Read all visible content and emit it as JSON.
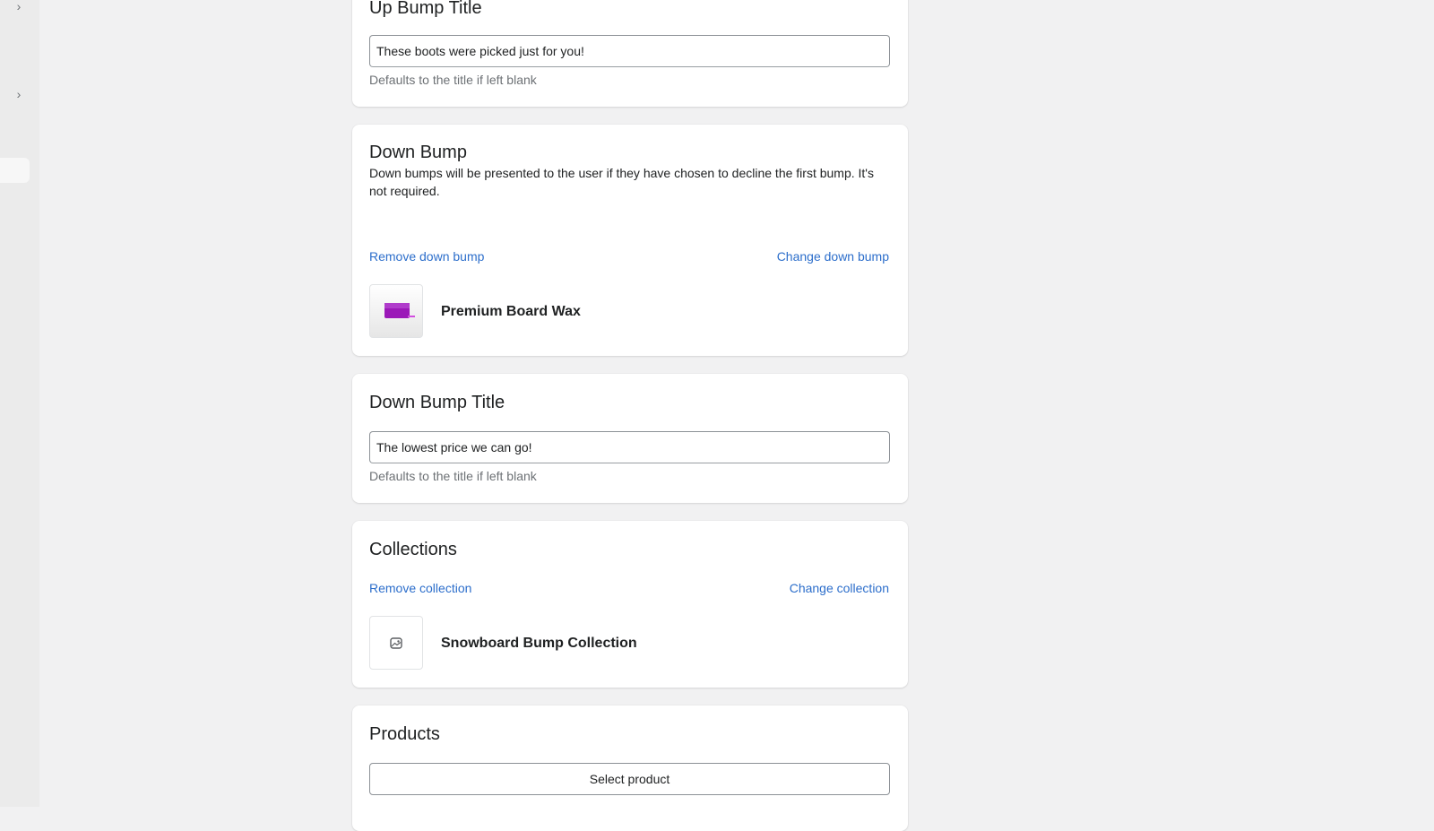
{
  "sidebar": {
    "icons": [
      "chevron-right-icon",
      "chevron-right-icon"
    ]
  },
  "up_bump_title_card": {
    "title": "Up Bump Title",
    "input_value": "These boots were picked just for you!",
    "help_text": "Defaults to the title if left blank"
  },
  "down_bump_card": {
    "title": "Down Bump",
    "description": "Down bumps will be presented to the user if they have chosen to decline the first bump. It's not required.",
    "remove_label": "Remove down bump",
    "change_label": "Change down bump",
    "product_name": "Premium Board Wax",
    "product_color": "#9b18b8"
  },
  "down_bump_title_card": {
    "title": "Down Bump Title",
    "input_value": "The lowest price we can go!",
    "help_text": "Defaults to the title if left blank"
  },
  "collections_card": {
    "title": "Collections",
    "remove_label": "Remove collection",
    "change_label": "Change collection",
    "collection_name": "Snowboard Bump Collection",
    "thumb_icon": "image-placeholder-icon"
  },
  "products_card": {
    "title": "Products",
    "select_label": "Select product"
  },
  "colors": {
    "link": "#2c6ecb",
    "background": "#f1f1f2",
    "card": "#ffffff"
  }
}
